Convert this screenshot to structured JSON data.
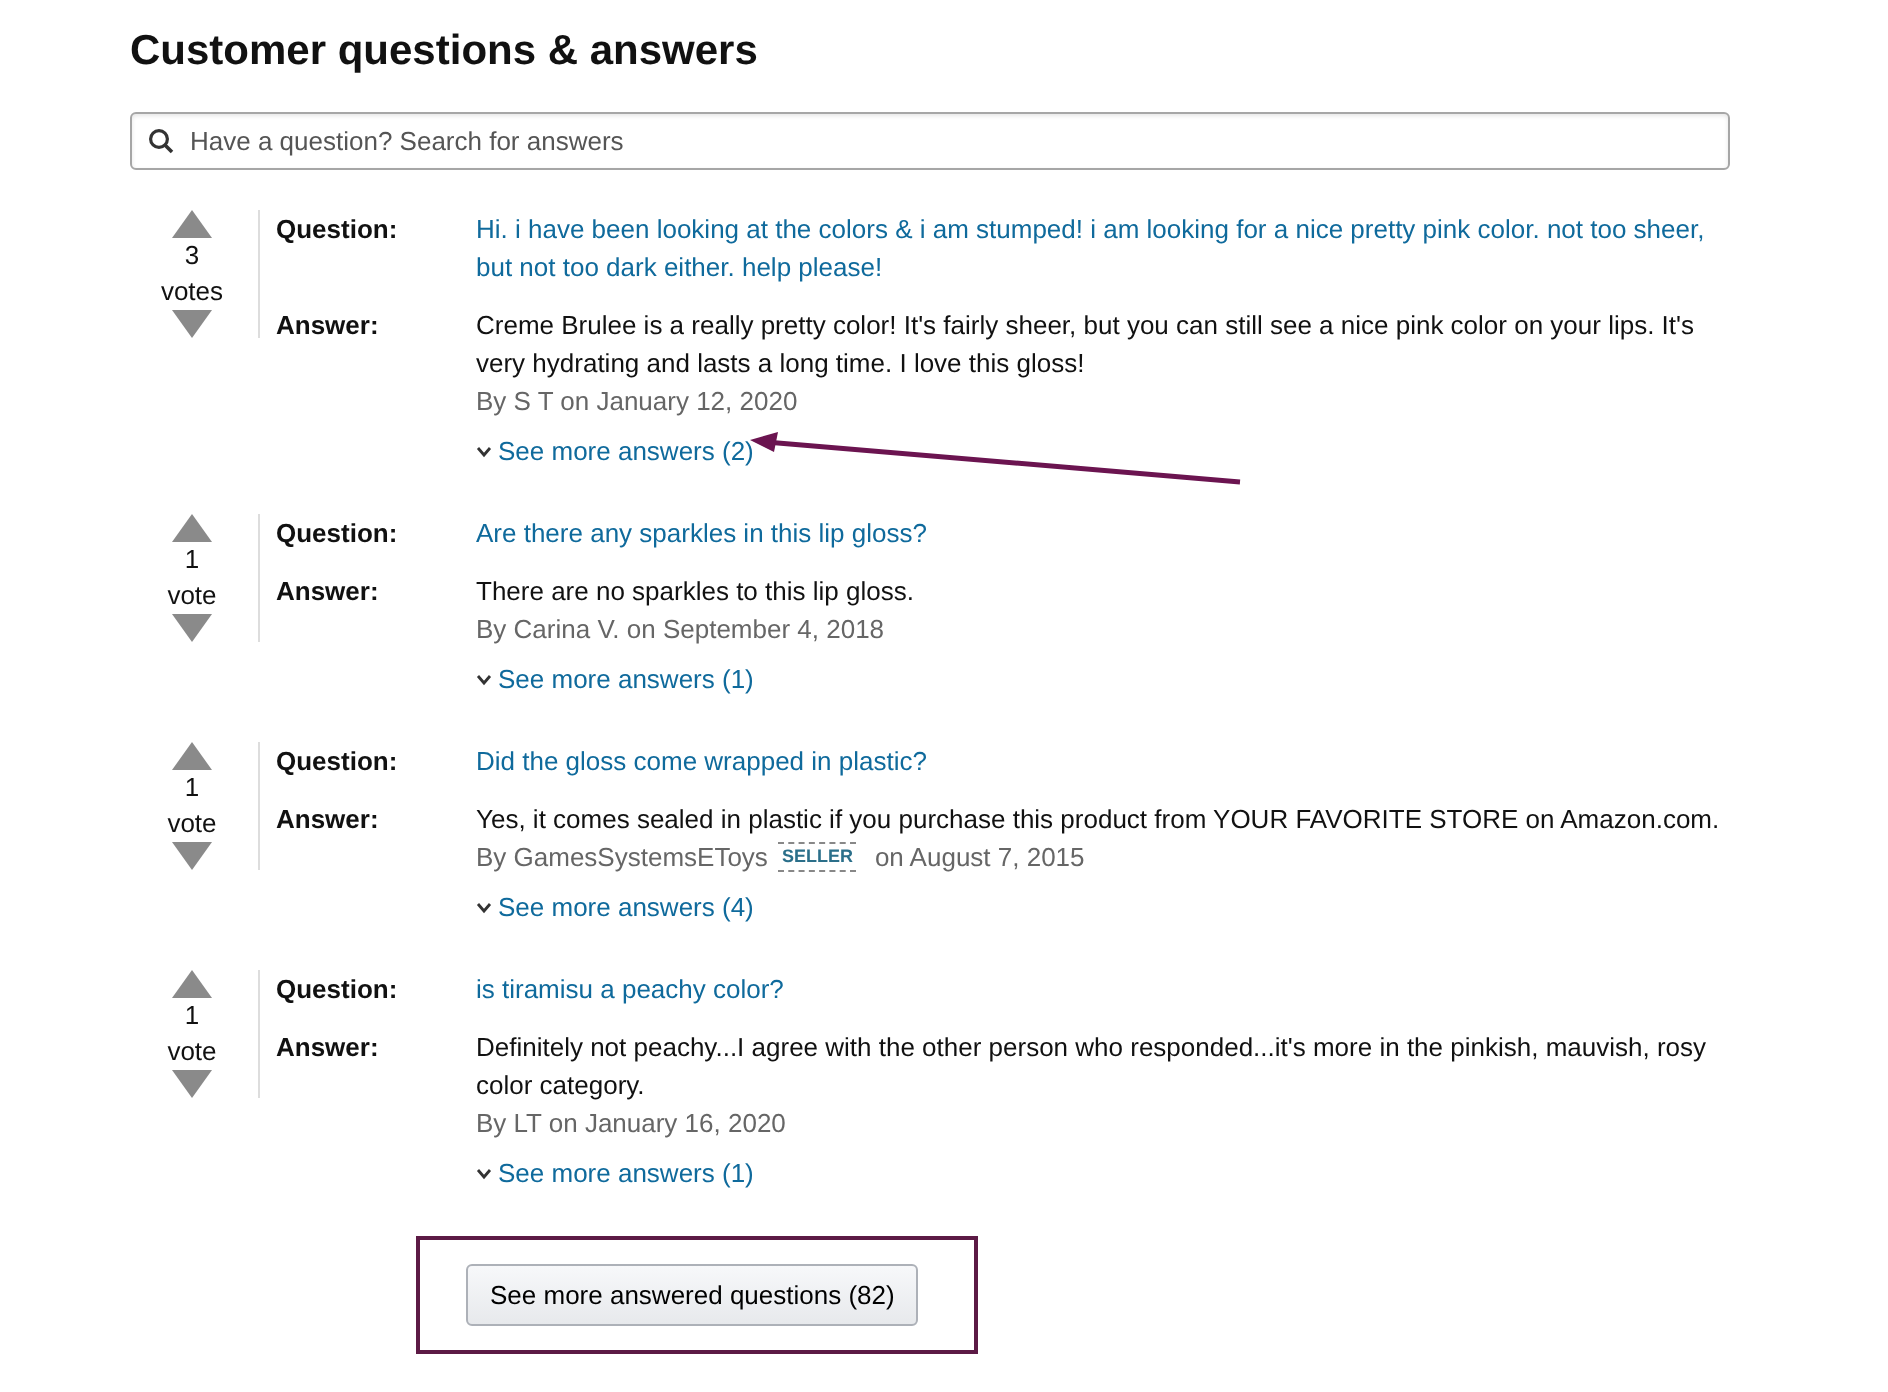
{
  "title": "Customer questions & answers",
  "search": {
    "placeholder": "Have a question? Search for answers"
  },
  "questions": [
    {
      "votes": "3",
      "vote_label": "votes",
      "question_label": "Question:",
      "question": "Hi. i have been looking at the colors & i am stumped! i am looking for a nice pretty pink color. not too sheer, but not too dark either. help please!",
      "answer_label": "Answer:",
      "answer": "Creme Brulee is a really pretty color! It's fairly sheer, but you can still see a nice pink color on your lips. It's very hydrating and lasts a long time. I love this gloss!",
      "byline": "By S T on January 12, 2020",
      "more": "See more answers (2)",
      "annotated": true
    },
    {
      "votes": "1",
      "vote_label": "vote",
      "question_label": "Question:",
      "question": "Are there any sparkles in this lip gloss?",
      "answer_label": "Answer:",
      "answer": "There are no sparkles to this lip gloss.",
      "byline": "By Carina V. on September 4, 2018",
      "more": "See more answers (1)",
      "annotated": false
    },
    {
      "votes": "1",
      "vote_label": "vote",
      "question_label": "Question:",
      "question": "Did the gloss come wrapped in plastic?",
      "answer_label": "Answer:",
      "answer": "Yes, it comes sealed in plastic if you purchase this product from YOUR FAVORITE STORE on Amazon.com.",
      "byline": "By GamesSystemsEToys",
      "badge": "SELLER",
      "date": "on August 7, 2015",
      "more": "See more answers (4)",
      "annotated": false
    },
    {
      "votes": "1",
      "vote_label": "vote",
      "question_label": "Question:",
      "question": "is tiramisu a peachy color?",
      "answer_label": "Answer:",
      "answer": "Definitely not peachy...I agree with the other person who responded...it's more in the pinkish, mauvish, rosy color category.",
      "byline": "By LT on January 16, 2020",
      "more": "See more answers (1)",
      "annotated": false
    }
  ],
  "more_button": {
    "label": "See more answered questions (82)",
    "highlighted": true
  }
}
